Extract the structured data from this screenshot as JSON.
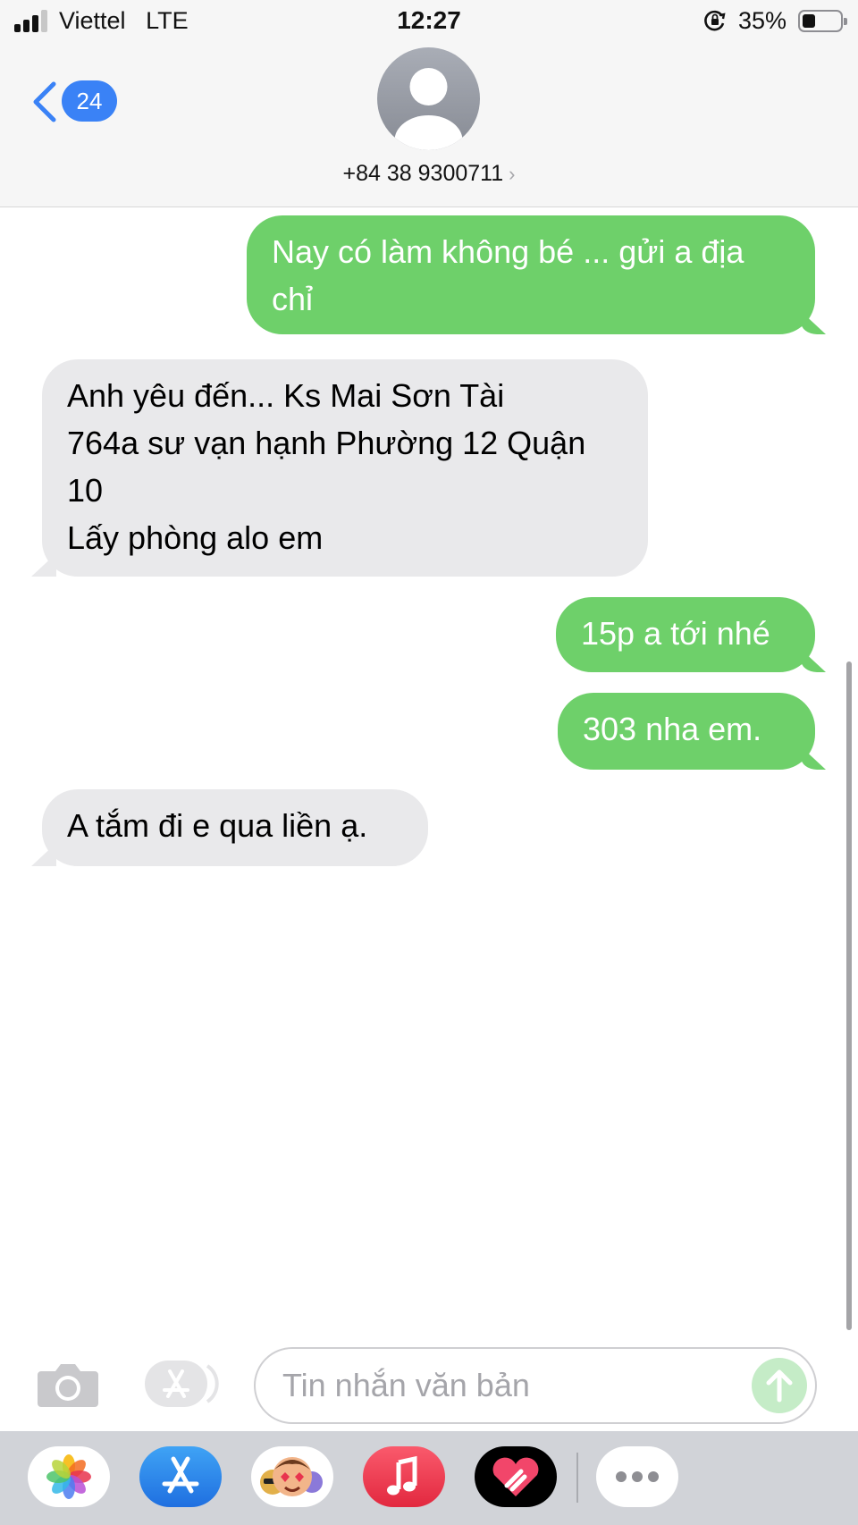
{
  "status_bar": {
    "carrier": "Viettel",
    "network": "LTE",
    "time": "12:27",
    "battery_percent": "35%",
    "battery_level": 0.35,
    "signal_bars": 3,
    "signal_bars_total": 4
  },
  "header": {
    "back_badge": "24",
    "contact": "+84 38 9300711",
    "contact_chevron": "›"
  },
  "messages": [
    {
      "direction": "sent",
      "lines": [
        "Nay có làm không bé ... gửi a địa",
        "chỉ"
      ]
    },
    {
      "direction": "received",
      "lines": [
        "Anh yêu đến... Ks Mai Sơn Tài",
        "764a sư vạn hạnh Phường 12 Quận",
        "10",
        "Lấy phòng alo em"
      ]
    },
    {
      "direction": "sent",
      "lines": [
        "15p a tới nhé"
      ]
    },
    {
      "direction": "sent",
      "lines": [
        "303 nha em."
      ]
    },
    {
      "direction": "received",
      "lines": [
        "A tắm đi e qua liền ạ."
      ]
    }
  ],
  "composer": {
    "placeholder": "Tin nhắn văn bản",
    "value": ""
  },
  "app_drawer": {
    "apps": [
      "photos-icon",
      "app-store-icon",
      "memoji-icon",
      "music-icon",
      "digital-touch-icon",
      "more-icon"
    ]
  },
  "colors": {
    "sent_bubble": "#6ed06a",
    "received_bubble": "#e9e9eb",
    "accent_blue": "#3a82f6",
    "header_bg": "#f6f6f6",
    "drawer_bg": "#d1d3d8"
  }
}
